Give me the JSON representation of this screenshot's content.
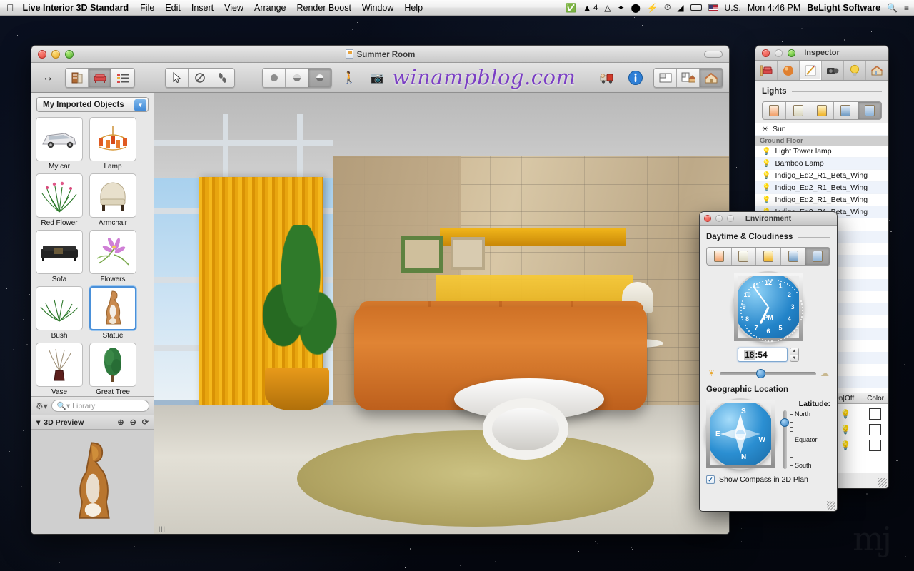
{
  "menubar": {
    "apple_icon": "apple-logo-icon",
    "app_name": "Live Interior 3D Standard",
    "menus": [
      "File",
      "Edit",
      "Insert",
      "View",
      "Arrange",
      "Render Boost",
      "Window",
      "Help"
    ],
    "status_icons": [
      "checkmark-badge-icon",
      "adobe-icon",
      "google-drive-icon",
      "dropbox-icon",
      "evernote-icon",
      "flash-icon",
      "time-machine-icon",
      "wifi-icon",
      "battery-icon"
    ],
    "adobe_count": "4",
    "input_source": "U.S.",
    "clock": "Mon 4:46 PM",
    "user_name": "BeLight Software",
    "spotlight_icon": "search-icon",
    "notification_icon": "notification-center-icon"
  },
  "window": {
    "title": "Summer Room",
    "watermark": "winampblog.com",
    "toolbar": {
      "resize_label": "arrows-horizontal-icon",
      "group1": [
        {
          "name": "building-view-button",
          "icon": "building-icon",
          "active": false
        },
        {
          "name": "furniture-view-button",
          "icon": "armchair-icon",
          "active": true
        },
        {
          "name": "list-view-button",
          "icon": "list-icon",
          "active": false
        }
      ],
      "group2": [
        {
          "name": "select-tool-button",
          "icon": "cursor-arrow-icon",
          "active": false
        },
        {
          "name": "rotate-tool-button",
          "icon": "rotate-icon",
          "active": false
        },
        {
          "name": "measure-tool-button",
          "icon": "footsteps-icon",
          "active": false
        }
      ],
      "group3": [
        {
          "name": "shading-flat-button",
          "icon": "sphere-flat-icon",
          "active": false
        },
        {
          "name": "shading-gouraud-button",
          "icon": "sphere-half-icon",
          "active": false
        },
        {
          "name": "shading-render-button",
          "icon": "sphere-shaded-icon",
          "active": true
        }
      ],
      "walk_button": "walkthrough-icon",
      "camera_button": "camera-icon",
      "render_button": "render-truck-icon",
      "info_button": "info-icon",
      "layout_group": [
        {
          "name": "split-view-button",
          "icon": "split-view-icon",
          "active": false
        },
        {
          "name": "plan-and-3d-button",
          "icon": "plan-house-icon",
          "active": false
        },
        {
          "name": "3d-only-button",
          "icon": "house-icon",
          "active": true
        }
      ]
    }
  },
  "sidebar": {
    "collection_popup": "My Imported Objects",
    "objects": [
      {
        "label": "My car",
        "icon": "car-thumbnail",
        "selected": false
      },
      {
        "label": "Lamp",
        "icon": "chandelier-thumbnail",
        "selected": false
      },
      {
        "label": "Red Flower",
        "icon": "grass-flower-thumbnail",
        "selected": false
      },
      {
        "label": "Armchair",
        "icon": "armchair-thumbnail",
        "selected": false
      },
      {
        "label": "Sofa",
        "icon": "sofa-thumbnail",
        "selected": false
      },
      {
        "label": "Flowers",
        "icon": "flowers-thumbnail",
        "selected": false
      },
      {
        "label": "Bush",
        "icon": "bush-thumbnail",
        "selected": false
      },
      {
        "label": "Statue",
        "icon": "statue-thumbnail",
        "selected": true
      },
      {
        "label": "Vase",
        "icon": "vase-thumbnail",
        "selected": false
      },
      {
        "label": "Great Tree",
        "icon": "tree-thumbnail",
        "selected": false
      }
    ],
    "action_menu_icon": "gear-icon",
    "search_placeholder": "Library",
    "search_value": "",
    "preview": {
      "title": "3D Preview",
      "disclosure_icon": "triangle-down-icon",
      "zoom_in_icon": "zoom-in-icon",
      "zoom_out_icon": "zoom-out-icon",
      "rotate_icon": "rotate-icon",
      "content": "statue-3d-preview"
    }
  },
  "inspector": {
    "title": "Inspector",
    "tabs": [
      {
        "name": "object-tab",
        "icon": "furniture-icon",
        "active": false
      },
      {
        "name": "material-tab",
        "icon": "sphere-icon",
        "active": false
      },
      {
        "name": "edit-tab",
        "icon": "pencil-ruler-icon",
        "active": true
      },
      {
        "name": "camera-tab",
        "icon": "camera-icon",
        "active": false
      },
      {
        "name": "light-tab",
        "icon": "lightbulb-icon",
        "active": false
      },
      {
        "name": "building-tab",
        "icon": "house-icon",
        "active": false
      }
    ],
    "section_title": "Lights",
    "light_modes": [
      {
        "name": "light-mode-warm",
        "active": false
      },
      {
        "name": "light-mode-neutral",
        "active": false
      },
      {
        "name": "light-mode-bright",
        "active": false
      },
      {
        "name": "light-mode-cool",
        "active": false
      },
      {
        "name": "light-mode-time",
        "active": true
      }
    ],
    "lights": [
      {
        "label": "Sun",
        "icon": "sun-icon",
        "group": false
      },
      {
        "label": "Ground Floor",
        "icon": "",
        "group": true
      },
      {
        "label": "Light Tower lamp",
        "icon": "bulb-on-icon",
        "group": false
      },
      {
        "label": "Bamboo Lamp",
        "icon": "bulb-off-icon",
        "group": false
      },
      {
        "label": "Indigo_Ed2_R1_Beta_Wing",
        "icon": "bulb-off-icon",
        "group": false
      },
      {
        "label": "Indigo_Ed2_R1_Beta_Wing",
        "icon": "bulb-off-icon",
        "group": false
      },
      {
        "label": "Indigo_Ed2_R1_Beta_Wing",
        "icon": "bulb-off-icon",
        "group": false
      },
      {
        "label": "Indigo_Ed2_R1_Beta_Wing",
        "icon": "bulb-off-icon",
        "group": false
      }
    ],
    "columns": [
      "On|Off",
      "Color"
    ],
    "column_rows": [
      {
        "state": "bulb-on-icon",
        "color": "#ffffff"
      },
      {
        "state": "bulb-off-icon",
        "color": "#ffffff"
      },
      {
        "state": "bulb-on-icon",
        "color": "#ffffff"
      }
    ]
  },
  "environment": {
    "title": "Environment",
    "daytime_section": "Daytime & Cloudiness",
    "daytime_modes": [
      {
        "name": "daytime-sunset",
        "active": false
      },
      {
        "name": "daytime-overcast",
        "active": false
      },
      {
        "name": "daytime-sunny",
        "active": false
      },
      {
        "name": "daytime-night",
        "active": false
      },
      {
        "name": "daytime-custom-time",
        "active": true
      }
    ],
    "clock": {
      "numerals": [
        "12",
        "1",
        "2",
        "3",
        "4",
        "5",
        "6",
        "7",
        "8",
        "9",
        "10",
        "11"
      ],
      "meridiem": "PM"
    },
    "time_value": "18:54",
    "time_selected_part": "18",
    "time_separator": ":",
    "time_rest": "54",
    "cloud_slider": {
      "sun_icon": "sun-icon",
      "cloud_icon": "cloud-icon",
      "position_percent": 38
    },
    "geo_section": "Geographic Location",
    "compass": {
      "directions": [
        "N",
        "E",
        "S",
        "W"
      ]
    },
    "latitude_label": "Latitude:",
    "latitude_ticks": [
      "North",
      "",
      "",
      "",
      "Equator",
      "",
      "",
      "",
      "South"
    ],
    "latitude_position_percent": 14,
    "show_compass_label": "Show Compass in 2D Plan",
    "show_compass_checked": true,
    "checkmark": "✓"
  },
  "desktop": {
    "watermark": "mj"
  },
  "colors": {
    "accent_blue": "#2f7fc4",
    "selection_blue": "#4a90d9",
    "sofa_orange": "#d87a2c",
    "curtain_yellow": "#f4b81c",
    "watermark_purple": "#7b3fc4"
  }
}
